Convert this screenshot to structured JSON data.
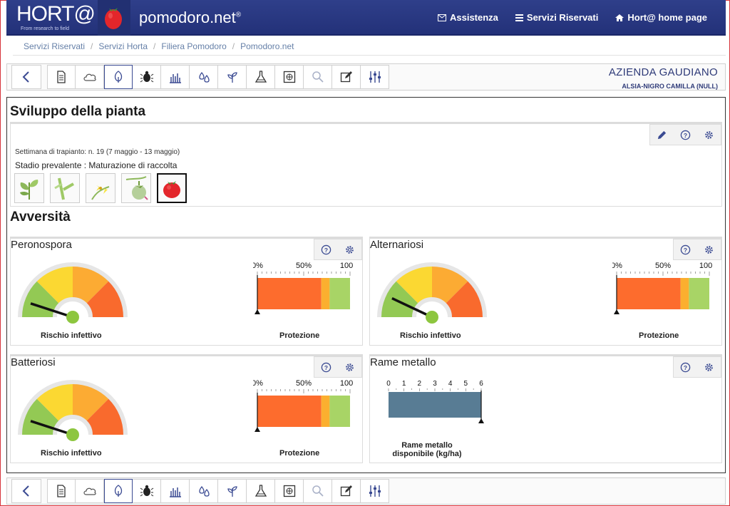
{
  "header": {
    "logo_text": "HORT@",
    "logo_tagline": "From research to field",
    "site_title": "pomodoro.net",
    "site_mark": "®",
    "nav": [
      {
        "label": "Assistenza",
        "icon": "envelope-icon"
      },
      {
        "label": "Servizi Riservati",
        "icon": "list-icon"
      },
      {
        "label": "Hort@ home page",
        "icon": "home-icon"
      }
    ]
  },
  "breadcrumb": [
    "Servizi Riservati",
    "Servizi Horta",
    "Filiera Pomodoro",
    "Pomodoro.net"
  ],
  "toolbar": {
    "buttons": [
      "back-icon",
      "document-icon",
      "cloud-icon",
      "leaf-icon",
      "bug-icon",
      "weeds-icon",
      "water-drops-icon",
      "plant-icon",
      "flask-icon",
      "soil-sample-icon",
      "search-icon",
      "edit-icon",
      "sliders-icon"
    ],
    "active_index": 3
  },
  "company": {
    "name": "AZIENDA GAUDIANO",
    "sub": "ALSIA-NIGRO CAMILLA (NULL)"
  },
  "plant": {
    "title": "Sviluppo della pianta",
    "week": "Settimana di trapianto: n. 19 (7 maggio - 13 maggio)",
    "stage": "Stadio prevalente :  Maturazione di raccolta",
    "stages": [
      "leaves-stage",
      "stem-stage",
      "flower-stage",
      "green-fruit-stage",
      "ripe-fruit-stage"
    ],
    "selected_stage": 4
  },
  "adversity": {
    "title": "Avversità",
    "gauge_label": "Rischio infettivo",
    "protection_label": "Protezione",
    "protection_ticks": [
      "0%",
      "50%",
      "100%"
    ],
    "cards": [
      {
        "title": "Peronospora",
        "risk_level": 0.1,
        "protection": {
          "red": 0.69,
          "orange": 0.09,
          "green": 0.22,
          "marker": 0.0
        }
      },
      {
        "title": "Alternariosi",
        "risk_level": 0.14,
        "protection": {
          "red": 0.69,
          "orange": 0.09,
          "green": 0.22,
          "marker": 0.0
        }
      },
      {
        "title": "Batteriosi",
        "risk_level": 0.1,
        "protection": {
          "red": 0.69,
          "orange": 0.09,
          "green": 0.22,
          "marker": 0.0
        }
      }
    ]
  },
  "copper": {
    "title": "Rame metallo",
    "label": "Rame metallo disponibile (kg/ha)",
    "ticks": [
      "0",
      "1",
      "2",
      "3",
      "4",
      "5",
      "6"
    ],
    "value": 6,
    "max": 6
  },
  "colors": {
    "header": "#26347c",
    "risk_green": "#93c954",
    "risk_yellow": "#fbd832",
    "risk_orange": "#fcab33",
    "risk_red": "#f96a2d",
    "prot_red": "#fd6c2d",
    "prot_orange": "#fbaf2f",
    "prot_green": "#a8d466",
    "copper_bar": "#587c94"
  }
}
